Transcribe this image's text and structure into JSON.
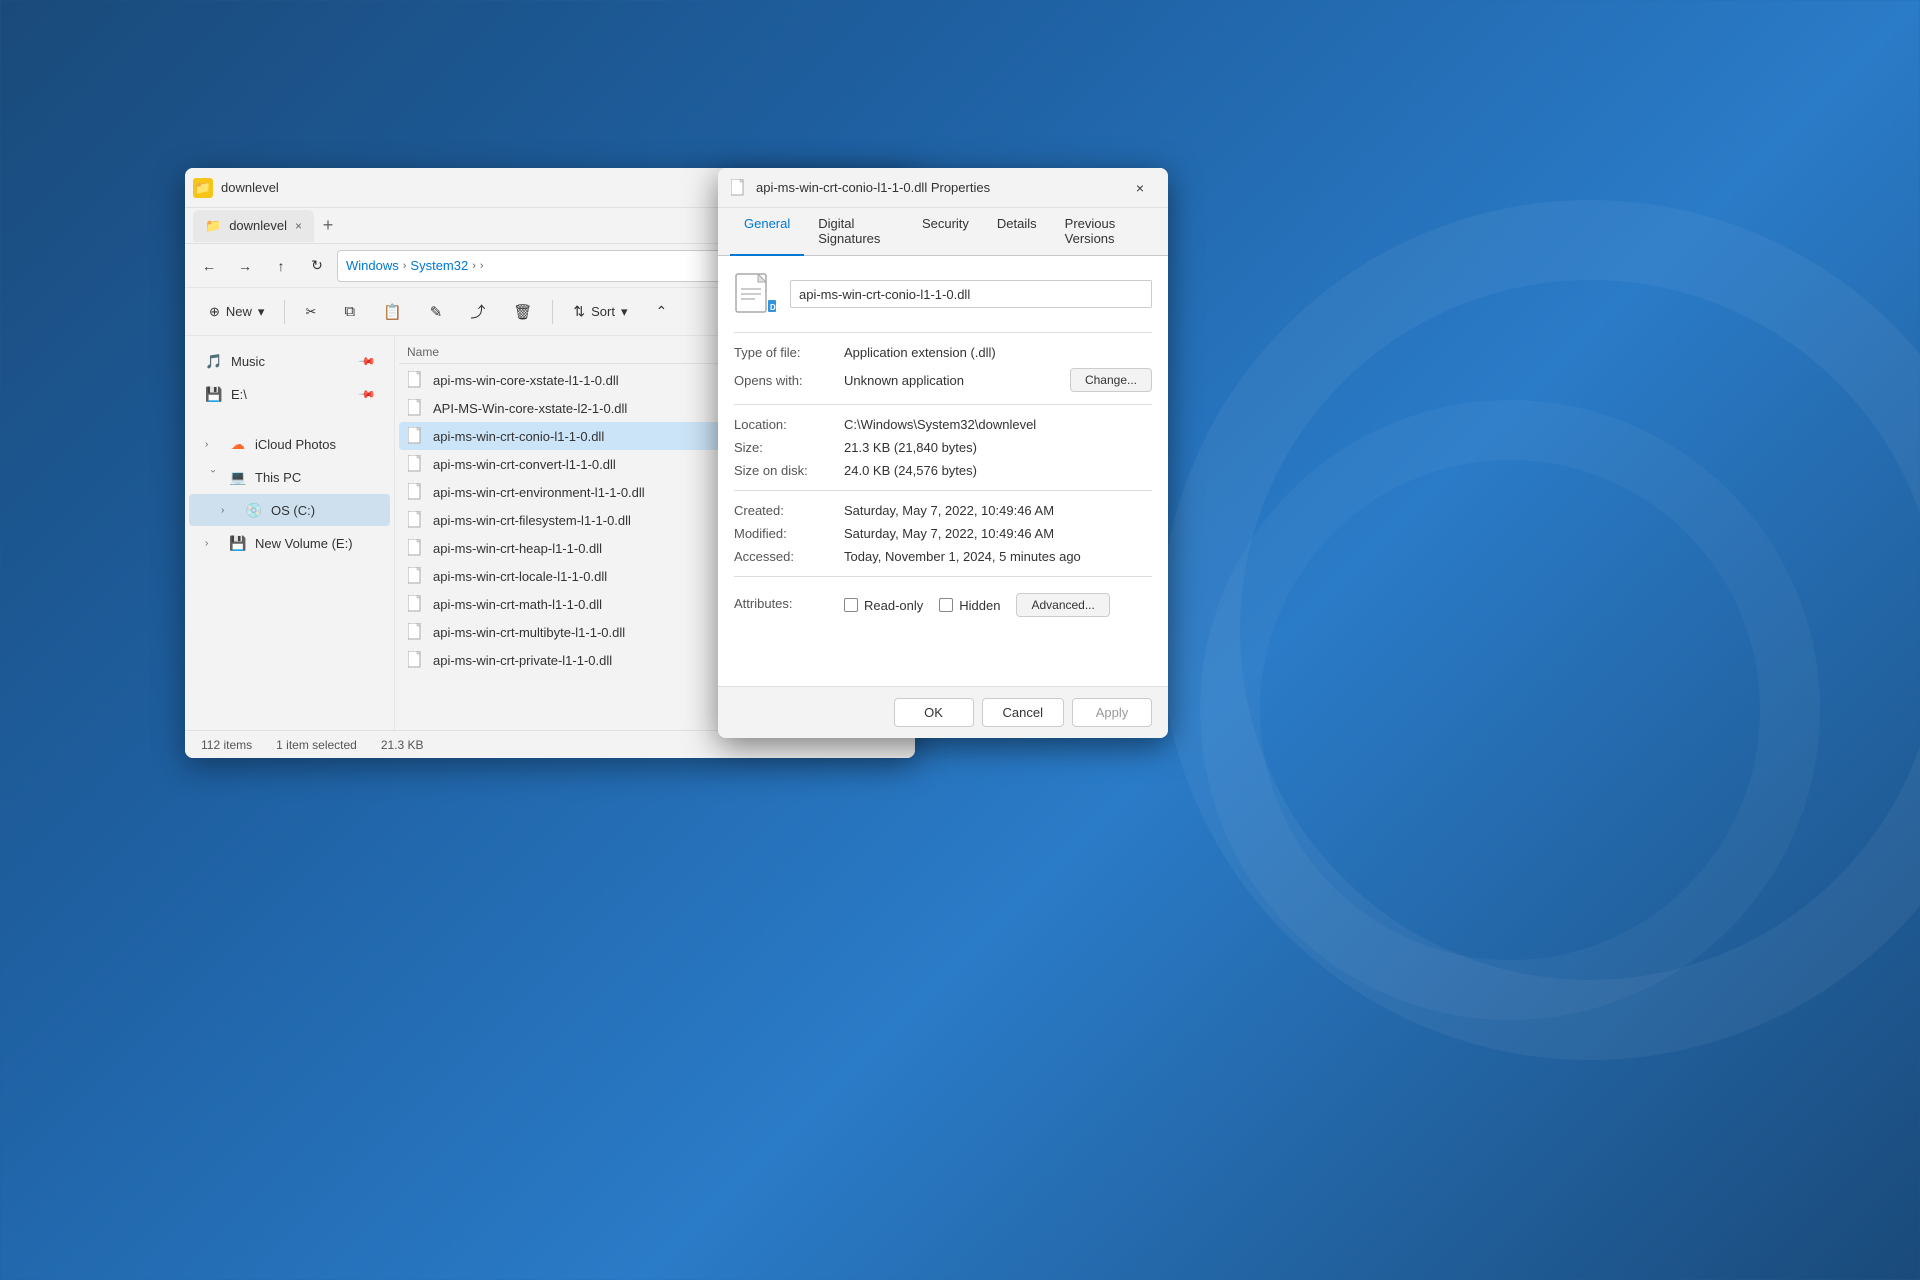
{
  "explorer": {
    "tab_title": "downlevel",
    "tab_close": "×",
    "tab_add": "+",
    "nav": {
      "back_btn": "←",
      "forward_btn": "→",
      "up_btn": "↑",
      "refresh_btn": "↻",
      "view_btn": "□",
      "more_btn": "···",
      "breadcrumbs": [
        "Windows",
        "System32"
      ],
      "breadcrumb_sep": "›",
      "arrow_more": "›"
    },
    "toolbar": {
      "new_label": "New",
      "new_dropdown": "▾",
      "cut_icon": "✂",
      "copy_icon": "⧉",
      "paste_icon": "📋",
      "rename_icon": "✎",
      "share_icon": "⤴",
      "delete_icon": "🗑",
      "sort_label": "Sort",
      "sort_dropdown": "▾",
      "sort_icon": "⇅",
      "expand_icon": "⌃"
    },
    "sidebar": {
      "items": [
        {
          "label": "Music",
          "icon": "🎵",
          "pinned": true
        },
        {
          "label": "E:\\",
          "icon": "💾",
          "pinned": true
        },
        {
          "label": "iCloud Photos",
          "icon": "☁",
          "expanded": false
        },
        {
          "label": "This PC",
          "icon": "💻",
          "expanded": true
        },
        {
          "label": "OS (C:)",
          "icon": "💿",
          "selected": true,
          "expanded": false
        },
        {
          "label": "New Volume (E:)",
          "icon": "💾",
          "expanded": false
        }
      ]
    },
    "file_list": {
      "column_name": "Name",
      "files": [
        {
          "name": "api-ms-win-core-xstate-l1-1-0.dll",
          "selected": false
        },
        {
          "name": "API-MS-Win-core-xstate-l2-1-0.dll",
          "selected": false
        },
        {
          "name": "api-ms-win-crt-conio-l1-1-0.dll",
          "selected": true
        },
        {
          "name": "api-ms-win-crt-convert-l1-1-0.dll",
          "selected": false
        },
        {
          "name": "api-ms-win-crt-environment-l1-1-0.dll",
          "selected": false
        },
        {
          "name": "api-ms-win-crt-filesystem-l1-1-0.dll",
          "selected": false
        },
        {
          "name": "api-ms-win-crt-heap-l1-1-0.dll",
          "selected": false
        },
        {
          "name": "api-ms-win-crt-locale-l1-1-0.dll",
          "selected": false
        },
        {
          "name": "api-ms-win-crt-math-l1-1-0.dll",
          "selected": false
        },
        {
          "name": "api-ms-win-crt-multibyte-l1-1-0.dll",
          "selected": false
        },
        {
          "name": "api-ms-win-crt-private-l1-1-0.dll",
          "selected": false
        }
      ]
    },
    "status_bar": {
      "item_count": "112 items",
      "selected_info": "1 item selected",
      "selected_size": "21.3 KB"
    }
  },
  "properties_dialog": {
    "title": "api-ms-win-crt-conio-l1-1-0.dll Properties",
    "close_btn": "×",
    "tabs": [
      {
        "label": "General",
        "active": true
      },
      {
        "label": "Digital Signatures"
      },
      {
        "label": "Security"
      },
      {
        "label": "Details"
      },
      {
        "label": "Previous Versions"
      }
    ],
    "file_name": "api-ms-win-crt-conio-l1-1-0.dll",
    "properties": {
      "type_label": "Type of file:",
      "type_value": "Application extension (.dll)",
      "opens_label": "Opens with:",
      "opens_value": "Unknown application",
      "change_btn": "Change...",
      "location_label": "Location:",
      "location_value": "C:\\Windows\\System32\\downlevel",
      "size_label": "Size:",
      "size_value": "21.3 KB (21,840 bytes)",
      "size_on_disk_label": "Size on disk:",
      "size_on_disk_value": "24.0 KB (24,576 bytes)",
      "created_label": "Created:",
      "created_value": "Saturday, May 7, 2022, 10:49:46 AM",
      "modified_label": "Modified:",
      "modified_value": "Saturday, May 7, 2022, 10:49:46 AM",
      "accessed_label": "Accessed:",
      "accessed_value": "Today, November 1, 2024, 5 minutes ago",
      "attributes_label": "Attributes:",
      "readonly_label": "Read-only",
      "hidden_label": "Hidden",
      "advanced_btn": "Advanced..."
    },
    "footer": {
      "ok_btn": "OK",
      "cancel_btn": "Cancel",
      "apply_btn": "Apply"
    }
  }
}
